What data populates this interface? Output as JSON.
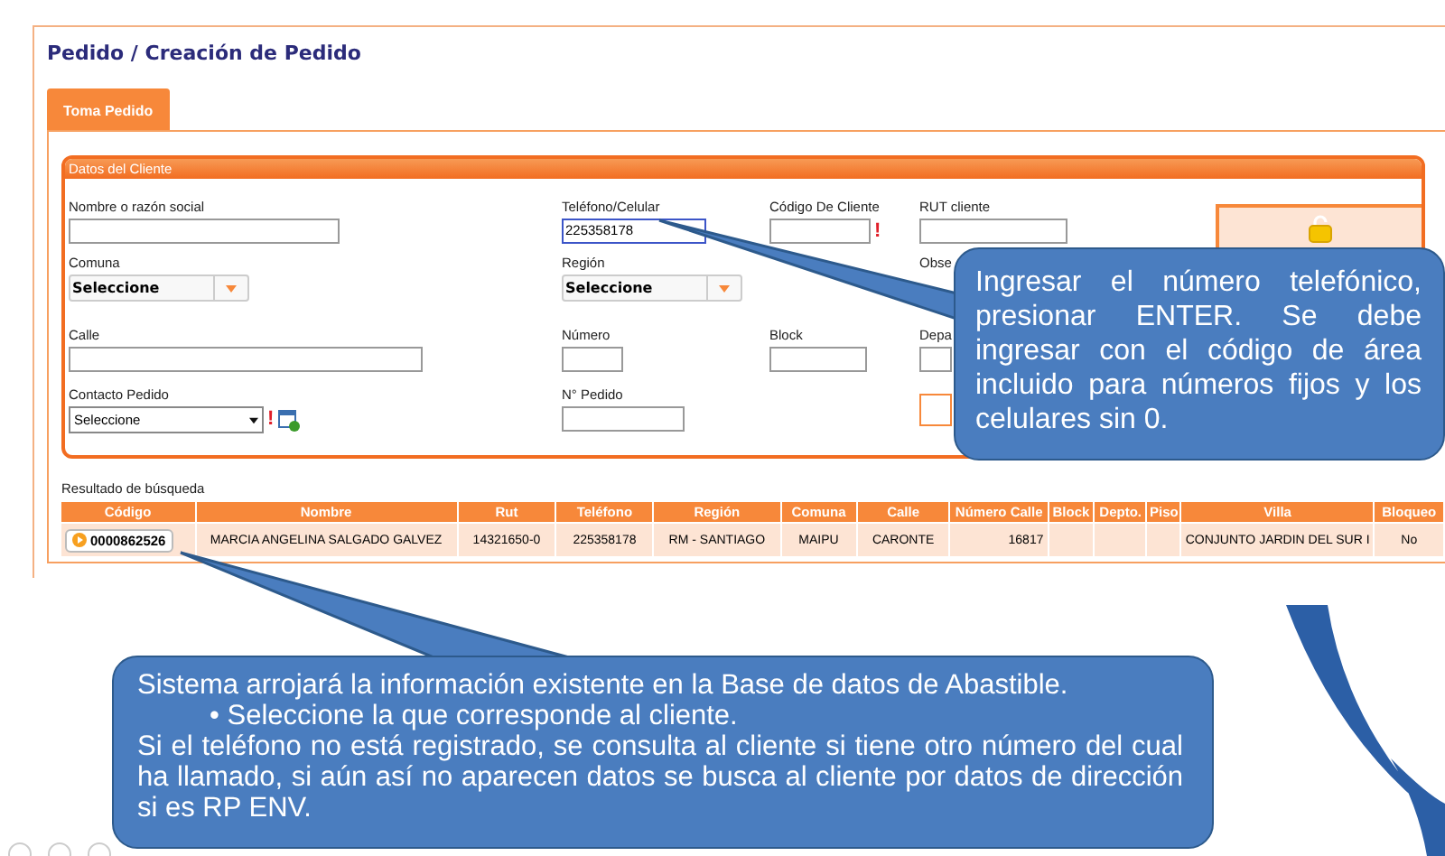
{
  "title": "Pedido / Creación de Pedido",
  "tabs": [
    {
      "label": "Toma Pedido",
      "selected": true
    }
  ],
  "panel": {
    "title": "Datos del Cliente",
    "fields": [
      {
        "kind": "text",
        "label": "Nombre o razón social"
      },
      {
        "kind": "text",
        "label": "Teléfono/Celular",
        "value": "225358178",
        "focused": true
      },
      {
        "kind": "text",
        "label": "Código De Cliente",
        "required_mark": "!"
      },
      {
        "kind": "text",
        "label": "RUT cliente"
      },
      {
        "kind": "combo",
        "label": "Comuna",
        "value": "Seleccione"
      },
      {
        "kind": "combo",
        "label": "Región",
        "value": "Seleccione"
      },
      {
        "kind": "label",
        "label": "Obse"
      },
      {
        "kind": "text",
        "label": "Calle"
      },
      {
        "kind": "text",
        "label": "Número"
      },
      {
        "kind": "text",
        "label": "Block"
      },
      {
        "kind": "text",
        "label": "Depa"
      },
      {
        "kind": "select",
        "label": "Contacto Pedido",
        "value": "Seleccione",
        "required_mark": "!"
      },
      {
        "kind": "text",
        "label": "N° Pedido"
      }
    ]
  },
  "results": {
    "label": "Resultado de búsqueda",
    "columns": [
      "Código",
      "Nombre",
      "Rut",
      "Teléfono",
      "Región",
      "Comuna",
      "Calle",
      "Número Calle",
      "Block",
      "Depto.",
      "Piso",
      "Villa",
      "Bloqueo"
    ],
    "rows": [
      {
        "cells": [
          "0000862526",
          "MARCIA ANGELINA SALGADO GALVEZ",
          "14321650-0",
          "225358178",
          "RM - SANTIAGO",
          "MAIPU",
          "CARONTE",
          "16817",
          "",
          "",
          "",
          "CONJUNTO JARDIN DEL SUR I",
          "No"
        ]
      }
    ]
  },
  "callouts": [
    {
      "lines": [
        {
          "kind": "justify",
          "text": "Ingresar el número telefónico, presionar ENTER. Se debe ingresar con el código de área incluido para números fijos y los celulares sin 0."
        }
      ]
    },
    {
      "lines": [
        {
          "kind": "plain",
          "text": "Sistema arrojará la información existente en la Base de datos de Abastible."
        },
        {
          "kind": "bullet",
          "text": "• Seleccione la que corresponde al cliente."
        },
        {
          "kind": "justify",
          "text": "Si el teléfono no está registrado, se consulta al cliente si tiene otro número del cual ha llamado, si aún así no aparecen datos se busca al cliente por datos de dirección si es RP ENV."
        }
      ]
    }
  ]
}
